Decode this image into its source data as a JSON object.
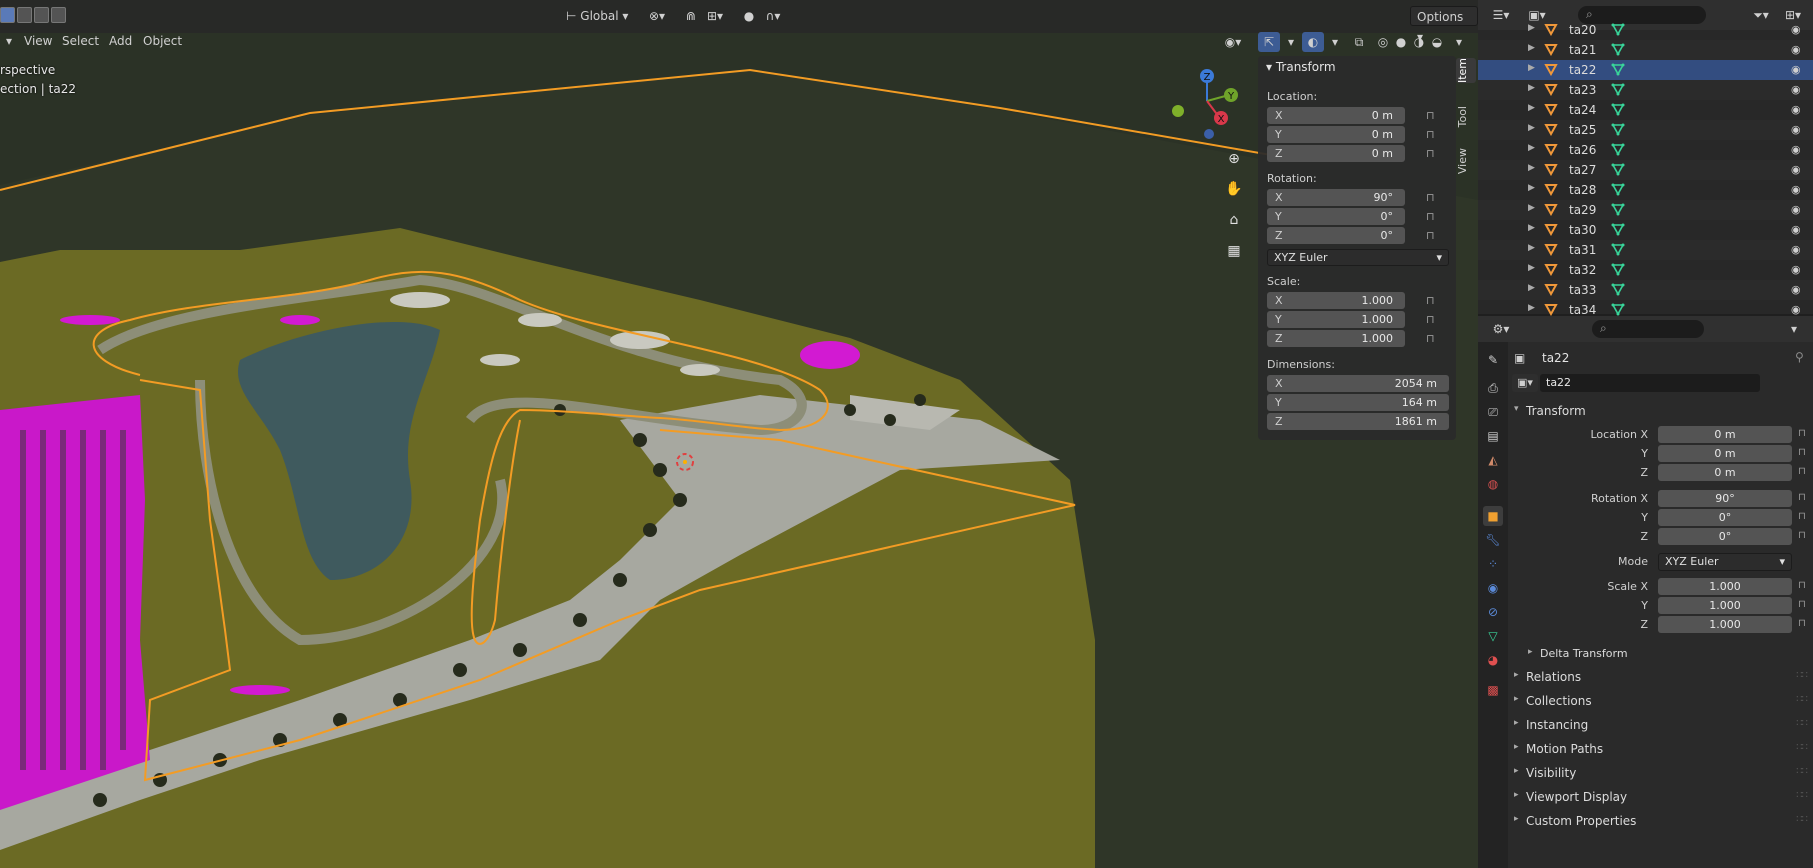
{
  "viewport": {
    "header": {
      "orientation": "Global",
      "options": "Options"
    },
    "menu": {
      "view": "View",
      "select": "Select",
      "add": "Add",
      "object": "Object"
    },
    "overlay": {
      "line1": "rspective",
      "line2": "ection | ta22"
    },
    "gizmo": {
      "x": "X",
      "y": "Y",
      "z": "Z"
    }
  },
  "npanel": {
    "title": "Transform",
    "location_label": "Location:",
    "location": {
      "x": "0 m",
      "y": "0 m",
      "z": "0 m"
    },
    "rotation_label": "Rotation:",
    "rotation": {
      "x": "90°",
      "y": "0°",
      "z": "0°"
    },
    "rotation_mode": "XYZ Euler",
    "scale_label": "Scale:",
    "scale": {
      "x": "1.000",
      "y": "1.000",
      "z": "1.000"
    },
    "dimensions_label": "Dimensions:",
    "dimensions": {
      "x": "2054 m",
      "y": "164 m",
      "z": "1861 m"
    },
    "axis": {
      "x": "X",
      "y": "Y",
      "z": "Z"
    },
    "tabs": {
      "item": "Item",
      "tool": "Tool",
      "view": "View"
    }
  },
  "outliner": {
    "items": [
      {
        "name": "ta20",
        "selected": false
      },
      {
        "name": "ta21",
        "selected": false
      },
      {
        "name": "ta22",
        "selected": true
      },
      {
        "name": "ta23",
        "selected": false
      },
      {
        "name": "ta24",
        "selected": false
      },
      {
        "name": "ta25",
        "selected": false
      },
      {
        "name": "ta26",
        "selected": false
      },
      {
        "name": "ta27",
        "selected": false
      },
      {
        "name": "ta28",
        "selected": false
      },
      {
        "name": "ta29",
        "selected": false
      },
      {
        "name": "ta30",
        "selected": false
      },
      {
        "name": "ta31",
        "selected": false
      },
      {
        "name": "ta32",
        "selected": false
      },
      {
        "name": "ta33",
        "selected": false
      },
      {
        "name": "ta34",
        "selected": false
      }
    ]
  },
  "properties": {
    "object_name": "ta22",
    "name_field": "ta22",
    "transform_title": "Transform",
    "location_x_label": "Location X",
    "y_label": "Y",
    "z_label": "Z",
    "rotation_x_label": "Rotation X",
    "mode_label": "Mode",
    "scale_x_label": "Scale X",
    "location": {
      "x": "0 m",
      "y": "0 m",
      "z": "0 m"
    },
    "rotation": {
      "x": "90°",
      "y": "0°",
      "z": "0°"
    },
    "mode": "XYZ Euler",
    "scale": {
      "x": "1.000",
      "y": "1.000",
      "z": "1.000"
    },
    "delta_transform": "Delta Transform",
    "panels": [
      "Relations",
      "Collections",
      "Instancing",
      "Motion Paths",
      "Visibility",
      "Viewport Display",
      "Custom Properties"
    ]
  },
  "colors": {
    "selection_outline": "#f39c24",
    "terrain": "#6b6a24",
    "dark_terrain": "#2b3226",
    "water": "#3f5a5e",
    "magenta": "#d21ad2",
    "highlight": "#334d80"
  }
}
